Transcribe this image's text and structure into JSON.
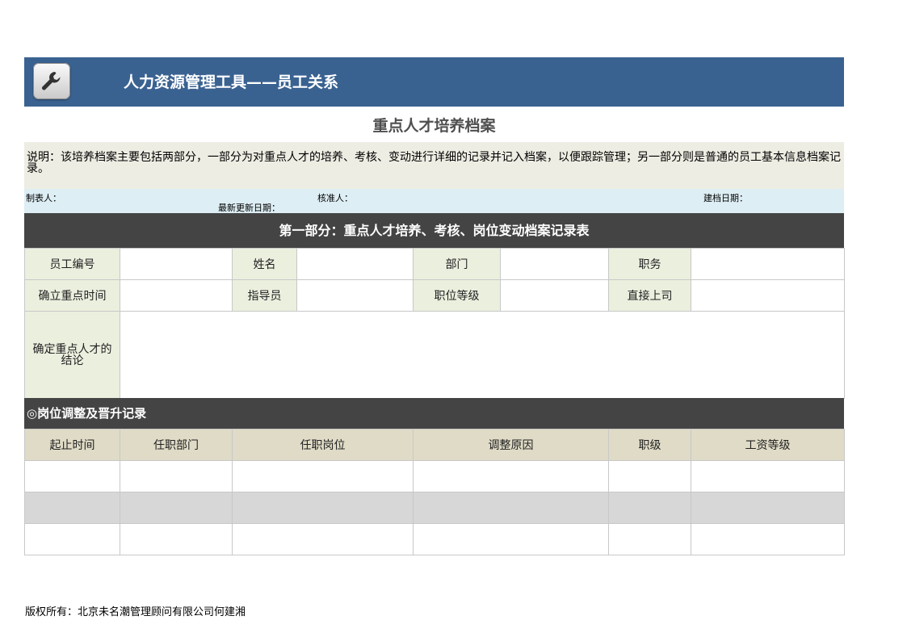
{
  "banner": {
    "title": "人力资源管理工具——员工关系",
    "icon": "wrench-icon"
  },
  "doc_title": "重点人才培养档案",
  "note": "说明：该培养档案主要包括两部分，一部分为对重点人才的培养、考核、变动进行详细的记录并记入档案，以便跟踪管理；另一部分则是普通的员工基本信息档案记录。",
  "meta": {
    "preparer": "制表人：",
    "last_updated": "最新更新日期：",
    "approver": "核准人：",
    "archive_date": "建档日期："
  },
  "part1": {
    "header": "第一部分：重点人才培养、考核、岗位变动档案记录表",
    "rows": [
      [
        "员工编号",
        "姓名",
        "部门",
        "职务"
      ],
      [
        "确立重点时间",
        "指导员",
        "职位等级",
        "直接上司"
      ]
    ],
    "conclusion_label": "确定重点人才的结论"
  },
  "section2": {
    "header": "◎岗位调整及晋升记录",
    "columns": [
      "起止时间",
      "任职部门",
      "任职岗位",
      "调整原因",
      "职级",
      "工资等级"
    ]
  },
  "footer": "版权所有：北京未名潮管理顾问有限公司何建湘",
  "colors": {
    "banner": "#3a6291",
    "section_header": "#444444",
    "label_cell": "#ebefde",
    "column_header": "#dfdbc6",
    "note_bg": "#eeede3",
    "meta_bg": "#ddeef4",
    "gray_row": "#d7d7d7"
  }
}
